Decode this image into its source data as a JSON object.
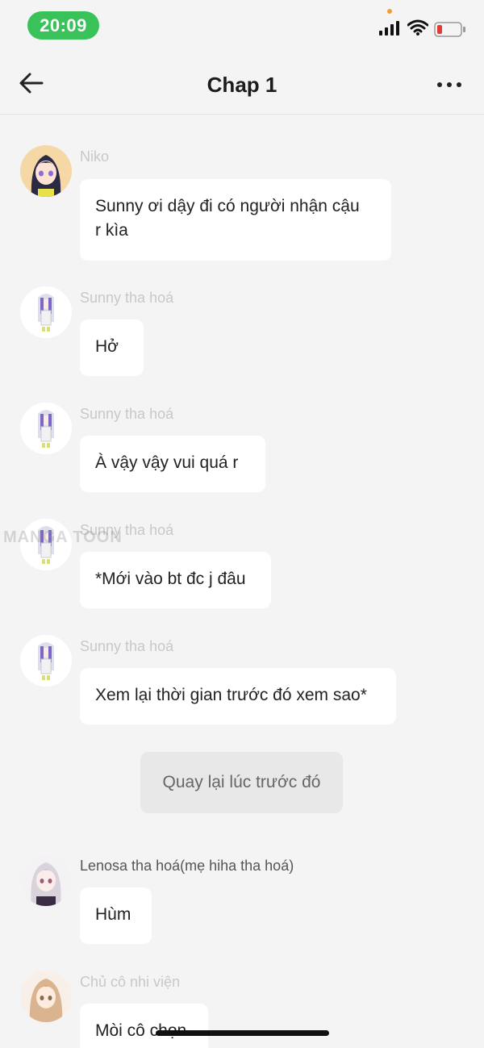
{
  "status_bar": {
    "time": "20:09",
    "battery_color": "#e53935",
    "time_pill_color": "#3ac25a"
  },
  "header": {
    "title": "Chap 1",
    "back_icon": "arrow-left-icon",
    "more_icon": "more-dots-icon"
  },
  "messages": [
    {
      "sender": "Niko",
      "lines": [
        "Sunny ơi dậy đi có người nhận cậu",
        "r kìa"
      ],
      "avatar": "niko-avatar"
    },
    {
      "sender": "Sunny tha hoá",
      "lines": [
        "Hở"
      ],
      "avatar": "sunny-avatar"
    },
    {
      "sender": "Sunny tha hoá",
      "lines": [
        "À vậy vậy vui quá r"
      ],
      "avatar": "sunny-avatar"
    },
    {
      "sender": "Sunny tha hoá",
      "lines": [
        "*Mới vào bt đc j đâu"
      ],
      "avatar": "sunny-avatar"
    },
    {
      "sender": "Sunny tha hoá",
      "lines": [
        "Xem lại thời gian trước đó xem sao*"
      ],
      "avatar": "sunny-avatar"
    },
    {
      "sender": "Lenosa tha hoá(mẹ hiha tha hoá)",
      "lines": [
        "Hùm"
      ],
      "avatar": "lenosa-avatar"
    },
    {
      "sender": "Chủ cô nhi viện",
      "lines": [
        "Mòi cô chọn"
      ],
      "avatar": "orphanage-owner-avatar"
    }
  ],
  "choice": {
    "label": "Quay lại lúc trước đó"
  },
  "watermark": "MANGA TOON"
}
